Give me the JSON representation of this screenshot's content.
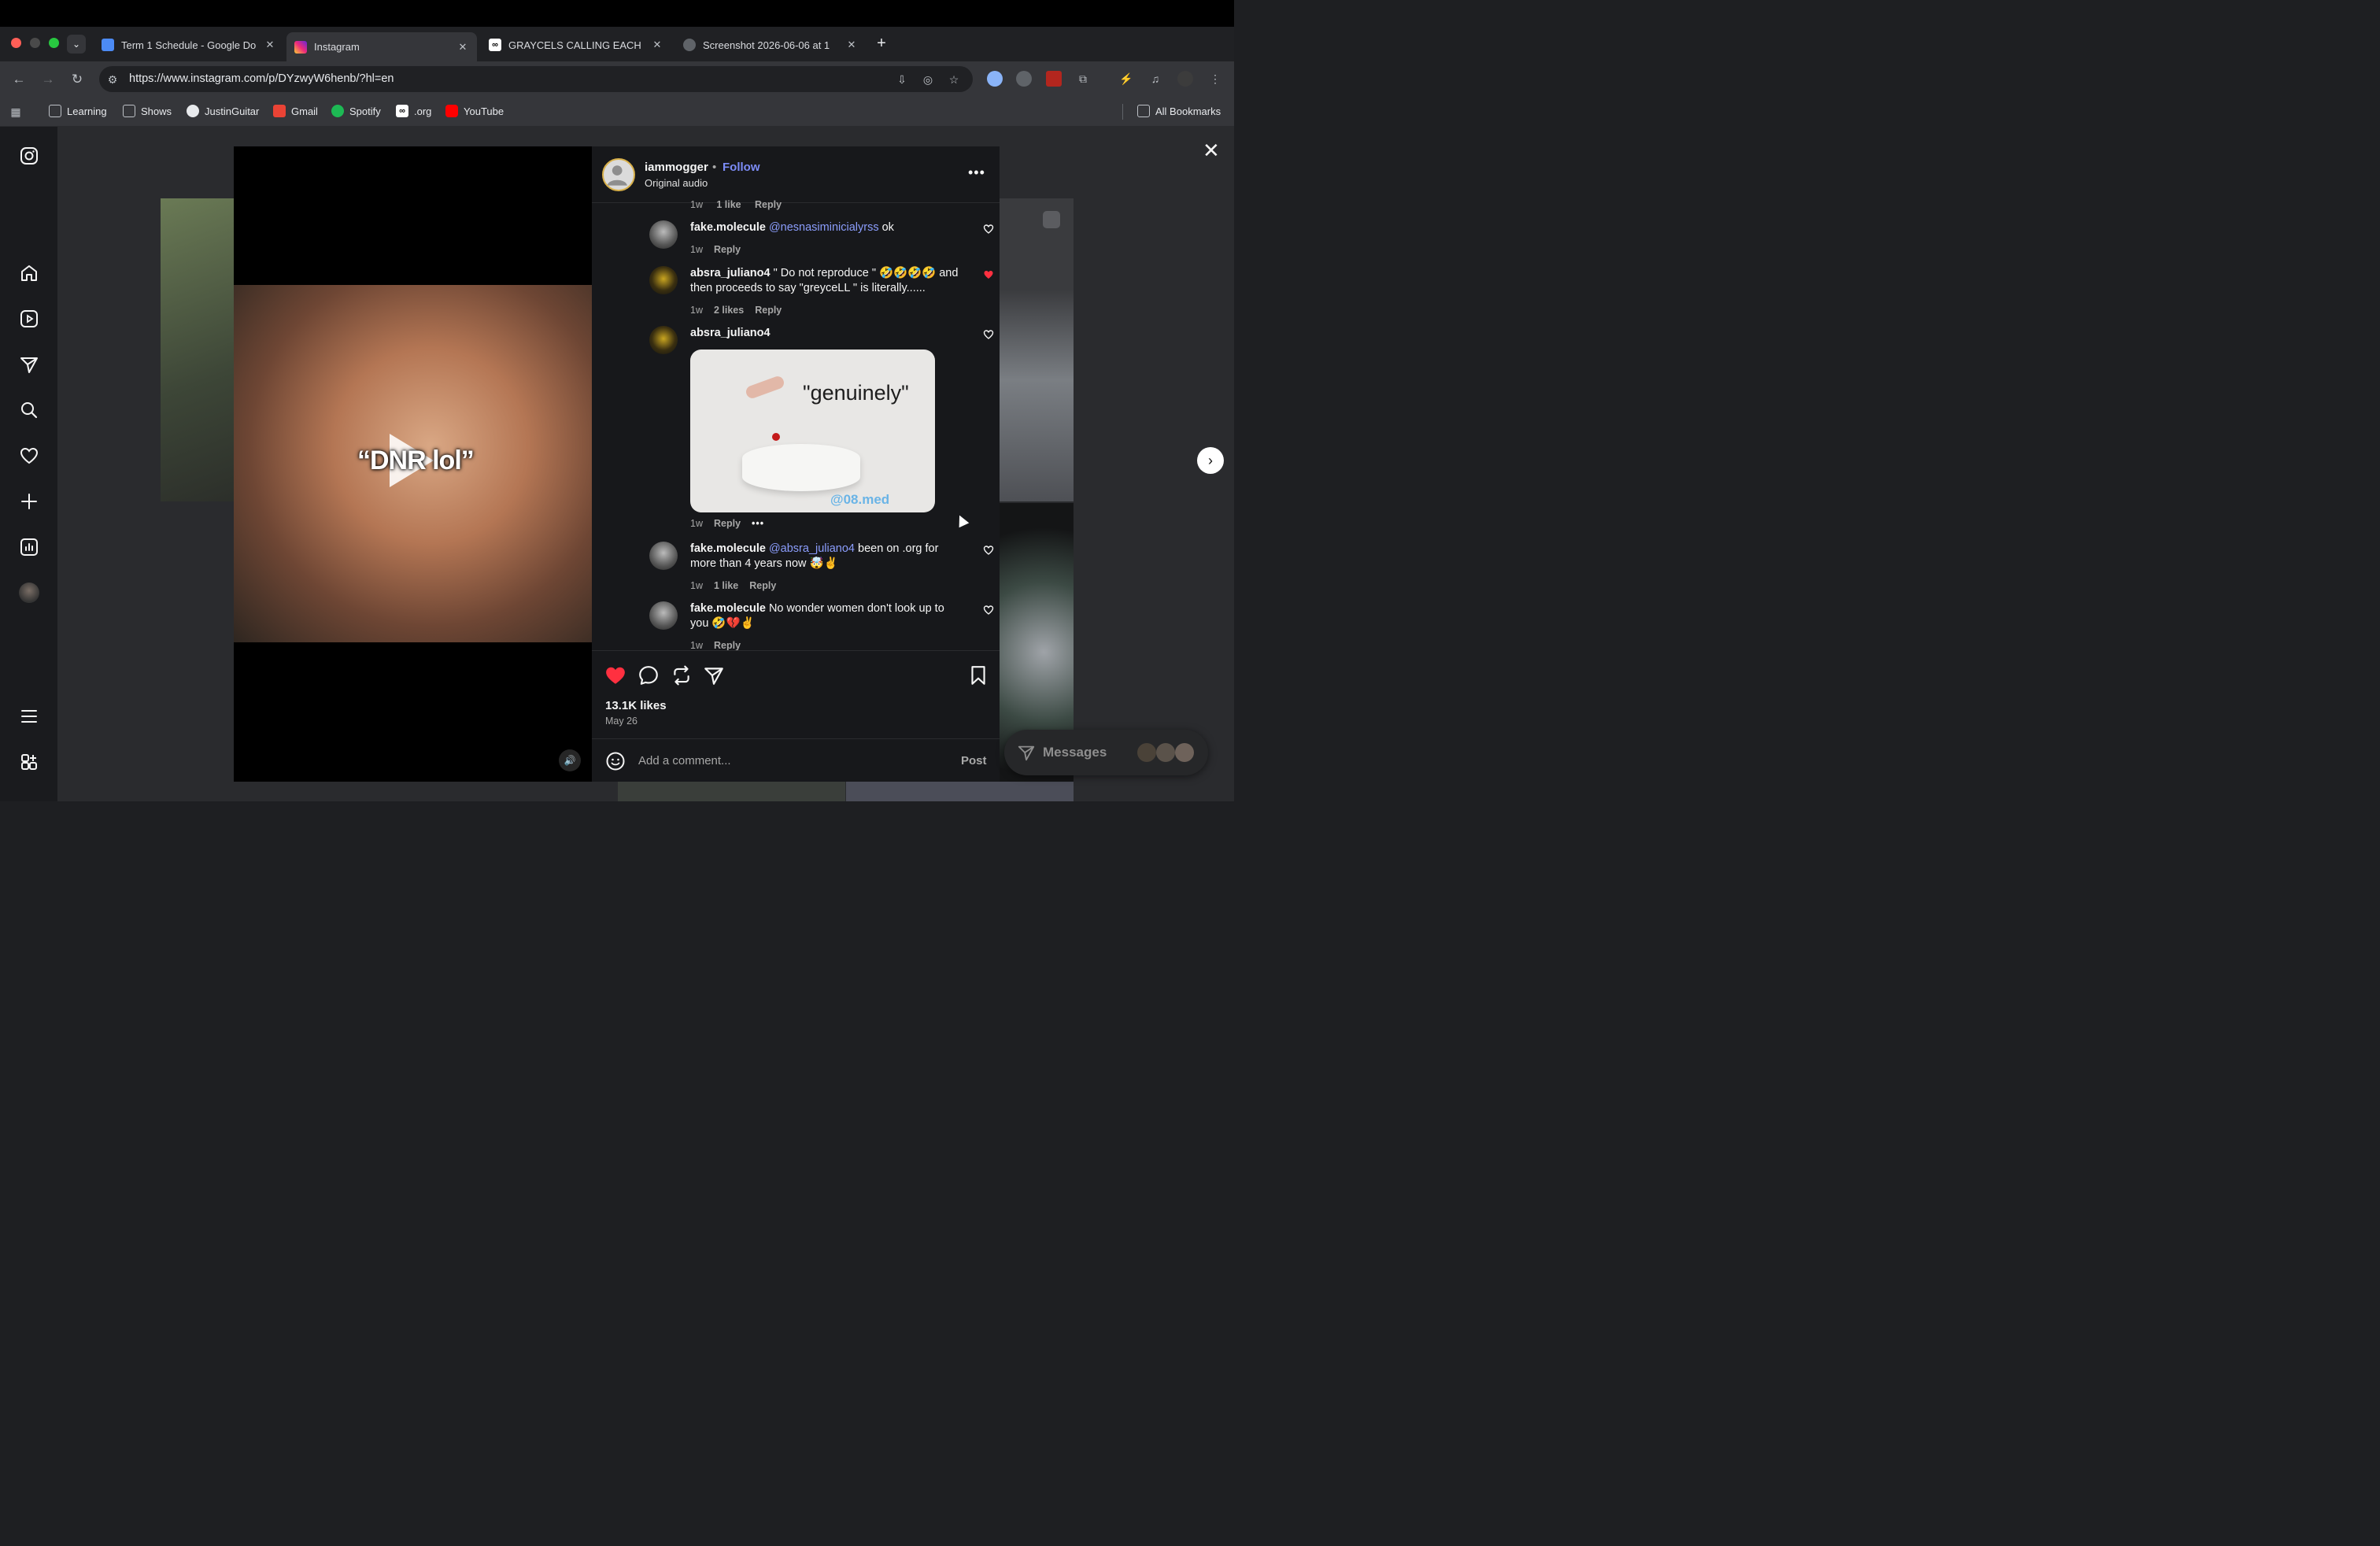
{
  "browser": {
    "tabs": [
      {
        "label": "Term 1 Schedule - Google Do",
        "icon": "google-docs-icon",
        "active": false
      },
      {
        "label": "Instagram",
        "icon": "instagram-icon",
        "active": true
      },
      {
        "label": "GRAYCELS CALLING EACH O",
        "icon": "infinity-icon",
        "active": false
      },
      {
        "label": "Screenshot 2026-06-06 at 1",
        "icon": "globe-icon",
        "active": false
      }
    ],
    "url": "https://www.instagram.com/p/DYzwyW6henb/?hl=en",
    "bookmarks": [
      {
        "label": "Learning",
        "icon": "folder-icon"
      },
      {
        "label": "Shows",
        "icon": "folder-icon"
      },
      {
        "label": "JustinGuitar",
        "icon": "justinguitar-icon"
      },
      {
        "label": "Gmail",
        "icon": "gmail-icon"
      },
      {
        "label": "Spotify",
        "icon": "spotify-icon"
      },
      {
        "label": ".org",
        "icon": "infinity-icon"
      },
      {
        "label": "YouTube",
        "icon": "youtube-icon"
      }
    ],
    "all_bookmarks": "All Bookmarks"
  },
  "post": {
    "author": "iammogger",
    "dot": "•",
    "follow": "Follow",
    "audio": "Original audio",
    "overlay_text": "“DNR lol”",
    "likes": "13.1K likes",
    "date": "May 26",
    "liked": true
  },
  "partial_meta": {
    "time": "1w",
    "likes": "1 like",
    "reply": "Reply"
  },
  "comments": [
    {
      "user": "fake.molecule",
      "mention": "@nesnasiminicialyrss",
      "text": " ok",
      "time": "1w",
      "likes": "",
      "reply": "Reply",
      "liked": false
    },
    {
      "user": "absra_juliano4",
      "mention": "",
      "text": " \" Do not reproduce \" 🤣🤣🤣🤣 and then proceeds to say \"greyceLL \" is literally......",
      "time": "1w",
      "likes": "2 likes",
      "reply": "Reply",
      "liked": true
    },
    {
      "user": "absra_juliano4",
      "mention": "",
      "text": "",
      "time": "1w",
      "likes": "",
      "reply": "Reply",
      "liked": false,
      "gif_text": "\"genuinely\"",
      "gif_watermark": "@08.med",
      "more": "•••"
    },
    {
      "user": "fake.molecule",
      "mention": "@absra_juliano4",
      "text": " been on .org for more than 4 years now 🤯✌️",
      "time": "1w",
      "likes": "1 like",
      "reply": "Reply",
      "liked": false
    },
    {
      "user": "fake.molecule",
      "mention": "",
      "text": " No wonder women don't look up to you 🤣💔✌️",
      "time": "1w",
      "likes": "",
      "reply": "Reply",
      "liked": false
    }
  ],
  "composer": {
    "placeholder": "Add a comment...",
    "post": "Post"
  },
  "messages": {
    "label": "Messages"
  },
  "colors": {
    "accent": "#7c8cf7",
    "like_red": "#ff3040",
    "mention": "#8b9dfc"
  }
}
